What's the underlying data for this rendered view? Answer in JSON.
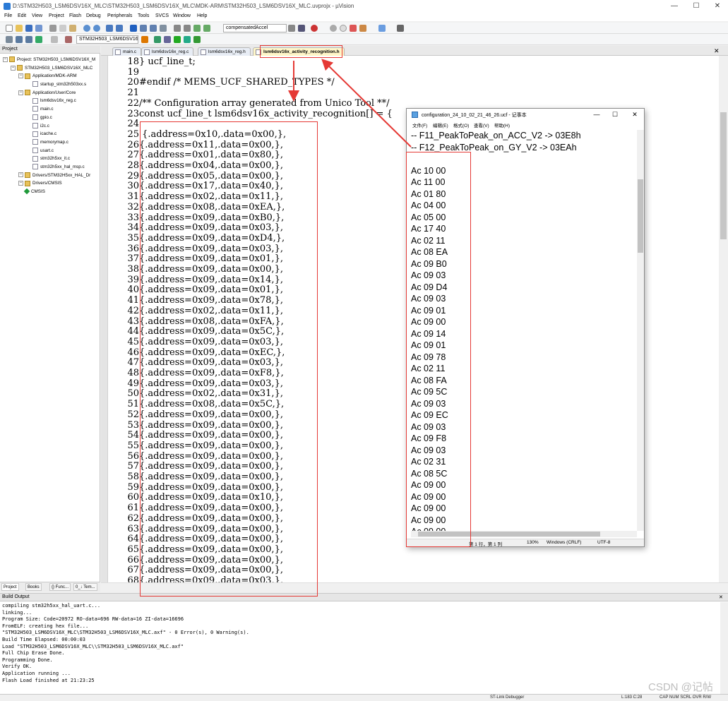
{
  "window": {
    "title": "D:\\STM32H503_LSM6DSV16X_MLC\\STM32H503_LSM6DSV16X_MLC\\MDK-ARM\\STM32H503_LSM6DSV16X_MLC.uvprojx - µVision"
  },
  "menu": [
    "File",
    "Edit",
    "View",
    "Project",
    "Flash",
    "Debug",
    "Peripherals",
    "Tools",
    "SVCS",
    "Window",
    "Help"
  ],
  "toolbar": {
    "find_value": "compensatedAccel",
    "target_value": "STM32H503_LSM6DSV16"
  },
  "project": {
    "header": "Project",
    "tree": [
      {
        "label": "Project: STM32H503_LSM6DSV16X_M",
        "kind": "root",
        "indent": 0
      },
      {
        "label": "STM32H503_LSM6DSV16X_MLC",
        "kind": "folder",
        "indent": 1
      },
      {
        "label": "Application/MDK-ARM",
        "kind": "folder",
        "indent": 2
      },
      {
        "label": "startup_stm32h503xx.s",
        "kind": "file",
        "indent": 3
      },
      {
        "label": "Application/User/Core",
        "kind": "folder",
        "indent": 2
      },
      {
        "label": "lsm6dsv16x_reg.c",
        "kind": "file",
        "indent": 3
      },
      {
        "label": "main.c",
        "kind": "file",
        "indent": 3
      },
      {
        "label": "gpio.c",
        "kind": "file",
        "indent": 3
      },
      {
        "label": "i2c.c",
        "kind": "file",
        "indent": 3
      },
      {
        "label": "icache.c",
        "kind": "file",
        "indent": 3
      },
      {
        "label": "memorymap.c",
        "kind": "file",
        "indent": 3
      },
      {
        "label": "usart.c",
        "kind": "file",
        "indent": 3
      },
      {
        "label": "stm32h5xx_it.c",
        "kind": "file",
        "indent": 3
      },
      {
        "label": "stm32h5xx_hal_msp.c",
        "kind": "file",
        "indent": 3
      },
      {
        "label": "Drivers/STM32H5xx_HAL_Dr",
        "kind": "folder",
        "indent": 2
      },
      {
        "label": "Drivers/CMSIS",
        "kind": "folder",
        "indent": 2
      },
      {
        "label": "CMSIS",
        "kind": "gem",
        "indent": 2
      }
    ],
    "bottom_tabs": [
      "Project",
      "Books",
      "{} Func...",
      "0_↓ Tem..."
    ]
  },
  "tabs": [
    {
      "label": "main.c",
      "active": false
    },
    {
      "label": "lsm6dsv16x_reg.c",
      "active": false
    },
    {
      "label": "lsm6dsv16x_reg.h",
      "active": false
    },
    {
      "label": "lsm6dsv16x_activity_recognition.h",
      "active": true
    }
  ],
  "code": {
    "lines": [
      {
        "n": "18",
        "t": "} ucf_line_t;"
      },
      {
        "n": "19",
        "t": ""
      },
      {
        "n": "20",
        "t": "#endif /* MEMS_UCF_SHARED_TYPES */"
      },
      {
        "n": "21",
        "t": ""
      },
      {
        "n": "22",
        "t": "/** Configuration array generated from Unico Tool **/"
      },
      {
        "n": "23",
        "t": "const ucf_line_t lsm6dsv16x_activity_recognition[] = {"
      },
      {
        "n": "24",
        "t": ""
      },
      {
        "n": "25",
        "t": "  {.address=0x10,.data=0x00,},"
      },
      {
        "n": "26",
        "t": "{.address=0x11,.data=0x00,},"
      },
      {
        "n": "27",
        "t": "{.address=0x01,.data=0x80,},"
      },
      {
        "n": "28",
        "t": "{.address=0x04,.data=0x00,},"
      },
      {
        "n": "29",
        "t": "{.address=0x05,.data=0x00,},"
      },
      {
        "n": "30",
        "t": "{.address=0x17,.data=0x40,},"
      },
      {
        "n": "31",
        "t": "{.address=0x02,.data=0x11,},"
      },
      {
        "n": "32",
        "t": "{.address=0x08,.data=0xEA,},"
      },
      {
        "n": "33",
        "t": "{.address=0x09,.data=0xB0,},"
      },
      {
        "n": "34",
        "t": "{.address=0x09,.data=0x03,},"
      },
      {
        "n": "35",
        "t": "{.address=0x09,.data=0xD4,},"
      },
      {
        "n": "36",
        "t": "{.address=0x09,.data=0x03,},"
      },
      {
        "n": "37",
        "t": "{.address=0x09,.data=0x01,},"
      },
      {
        "n": "38",
        "t": "{.address=0x09,.data=0x00,},"
      },
      {
        "n": "39",
        "t": "{.address=0x09,.data=0x14,},"
      },
      {
        "n": "40",
        "t": "{.address=0x09,.data=0x01,},"
      },
      {
        "n": "41",
        "t": "{.address=0x09,.data=0x78,},"
      },
      {
        "n": "42",
        "t": "{.address=0x02,.data=0x11,},"
      },
      {
        "n": "43",
        "t": "{.address=0x08,.data=0xFA,},"
      },
      {
        "n": "44",
        "t": "{.address=0x09,.data=0x5C,},"
      },
      {
        "n": "45",
        "t": "{.address=0x09,.data=0x03,},"
      },
      {
        "n": "46",
        "t": "{.address=0x09,.data=0xEC,},"
      },
      {
        "n": "47",
        "t": "{.address=0x09,.data=0x03,},"
      },
      {
        "n": "48",
        "t": "{.address=0x09,.data=0xF8,},"
      },
      {
        "n": "49",
        "t": "{.address=0x09,.data=0x03,},"
      },
      {
        "n": "50",
        "t": "{.address=0x02,.data=0x31,},"
      },
      {
        "n": "51",
        "t": "{.address=0x08,.data=0x5C,},"
      },
      {
        "n": "52",
        "t": "{.address=0x09,.data=0x00,},"
      },
      {
        "n": "53",
        "t": "{.address=0x09,.data=0x00,},"
      },
      {
        "n": "54",
        "t": "{.address=0x09,.data=0x00,},"
      },
      {
        "n": "55",
        "t": "{.address=0x09,.data=0x00,},"
      },
      {
        "n": "56",
        "t": "{.address=0x09,.data=0x00,},"
      },
      {
        "n": "57",
        "t": "{.address=0x09,.data=0x00,},"
      },
      {
        "n": "58",
        "t": "{.address=0x09,.data=0x00,},"
      },
      {
        "n": "59",
        "t": "{.address=0x09,.data=0x00,},"
      },
      {
        "n": "60",
        "t": "{.address=0x09,.data=0x10,},"
      },
      {
        "n": "61",
        "t": "{.address=0x09,.data=0x00,},"
      },
      {
        "n": "62",
        "t": "{.address=0x09,.data=0x00,},"
      },
      {
        "n": "63",
        "t": "{.address=0x09,.data=0x00,},"
      },
      {
        "n": "64",
        "t": "{.address=0x09,.data=0x00,},"
      },
      {
        "n": "65",
        "t": "{.address=0x09,.data=0x00,},"
      },
      {
        "n": "66",
        "t": "{.address=0x09,.data=0x00,},"
      },
      {
        "n": "67",
        "t": "{.address=0x09,.data=0x00,},"
      },
      {
        "n": "68",
        "t": "{.address=0x09,.data=0x03,},"
      }
    ]
  },
  "notepad": {
    "title": "configuration_24_10_02_21_46_26.ucf - 记事本",
    "menu": [
      "文件(F)",
      "编辑(E)",
      "格式(O)",
      "查看(V)",
      "帮助(H)"
    ],
    "lines": [
      "-- F11_PeakToPeak_on_ACC_V2 -> 03E8h",
      "-- F12_PeakToPeak_on_GY_V2 -> 03EAh",
      "",
      "Ac 10 00",
      "Ac 11 00",
      "Ac 01 80",
      "Ac 04 00",
      "Ac 05 00",
      "Ac 17 40",
      "Ac 02 11",
      "Ac 08 EA",
      "Ac 09 B0",
      "Ac 09 03",
      "Ac 09 D4",
      "Ac 09 03",
      "Ac 09 01",
      "Ac 09 00",
      "Ac 09 14",
      "Ac 09 01",
      "Ac 09 78",
      "Ac 02 11",
      "Ac 08 FA",
      "Ac 09 5C",
      "Ac 09 03",
      "Ac 09 EC",
      "Ac 09 03",
      "Ac 09 F8",
      "Ac 09 03",
      "Ac 02 31",
      "Ac 08 5C",
      "Ac 09 00",
      "Ac 09 00",
      "Ac 09 00",
      "Ac 09 00",
      "Ac 09 00"
    ],
    "status": {
      "position": "第 1 行，第 1 列",
      "zoom": "130%",
      "eol": "Windows (CRLF)",
      "encoding": "UTF-8"
    }
  },
  "build": {
    "header": "Build Output",
    "lines": [
      "compiling stm32h5xx_hal_uart.c...",
      "linking...",
      "Program Size: Code=20972 RO-data=696 RW-data=16 ZI-data=16696",
      "FromELF: creating hex file...",
      "\"STM32H503_LSM6DSV16X_MLC\\STM32H503_LSM6DSV16X_MLC.axf\" - 0 Error(s), 0 Warning(s).",
      "Build Time Elapsed:  00:00:03",
      "Load \"STM32H503_LSM6DSV16X_MLC\\\\STM32H503_LSM6DSV16X_MLC.axf\"",
      "Full Chip Erase Done.",
      "Programming Done.",
      "Verify OK.",
      "Application running ...",
      "Flash Load finished at 21:23:25"
    ]
  },
  "status": {
    "debugger": "ST-Link Debugger",
    "position": "L:183 C:28",
    "flags": "CAP  NUM  SCRL  OVR  R/W"
  },
  "watermark": "CSDN @记帖",
  "colors": {
    "annotation": "#e53935",
    "keyword": "#0000ff",
    "comment": "#008000",
    "hex": "#008080",
    "active_tab": "#fff6c8"
  }
}
